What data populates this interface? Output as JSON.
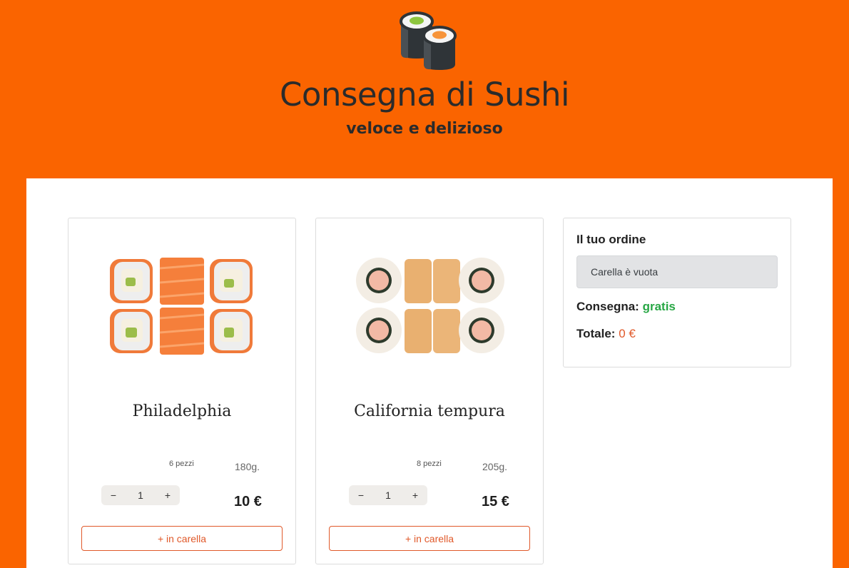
{
  "header": {
    "title": "Consegna di Sushi",
    "subtitle": "veloce e delizioso"
  },
  "colors": {
    "brand": "#fa6400",
    "accent": "#e0592a",
    "free": "#28a745"
  },
  "products": [
    {
      "title": "Philadelphia",
      "pieces": "6 pezzi",
      "weight": "180g.",
      "quantity": "1",
      "price": "10 €",
      "add_label": "+ in carella",
      "minus": "−",
      "plus": "+"
    },
    {
      "title": "California tempura",
      "pieces": "8 pezzi",
      "weight": "205g.",
      "quantity": "1",
      "price": "15 €",
      "add_label": "+ in carella",
      "minus": "−",
      "plus": "+"
    }
  ],
  "order": {
    "title": "Il tuo ordine",
    "empty_message": "Carella è vuota",
    "delivery_label": "Consegna:",
    "delivery_value": "gratis",
    "total_label": "Totale:",
    "total_value": "0 €"
  },
  "icons": {
    "logo": "sushi-logo-icon"
  }
}
